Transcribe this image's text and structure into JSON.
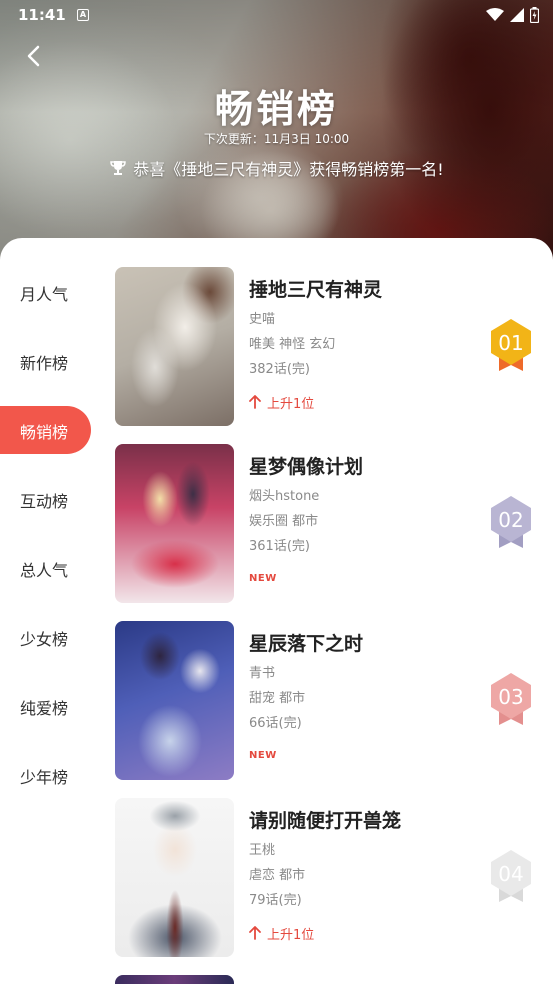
{
  "status_bar": {
    "time": "11:41",
    "notification_letter": "A"
  },
  "header": {
    "title": "畅销榜",
    "next_update": "下次更新：11月3日 10:00",
    "congrats": "恭喜《捶地三尺有神灵》获得畅销榜第一名!"
  },
  "sidebar": {
    "items": [
      {
        "label": "月人气"
      },
      {
        "label": "新作榜"
      },
      {
        "label": "畅销榜"
      },
      {
        "label": "互动榜"
      },
      {
        "label": "总人气"
      },
      {
        "label": "少女榜"
      },
      {
        "label": "纯爱榜"
      },
      {
        "label": "少年榜"
      }
    ],
    "active_label": "畅销榜"
  },
  "comics": [
    {
      "title": "捶地三尺有神灵",
      "author": "史喵",
      "tags": "唯美 神怪 玄幻",
      "episodes": "382话(完)",
      "badge_type": "rise",
      "badge_text": "上升1位",
      "rank": "01",
      "rank_color": "#f2b417"
    },
    {
      "title": "星梦偶像计划",
      "author": "烟头hstone",
      "tags": "娱乐圈 都市",
      "episodes": "361话(完)",
      "badge_type": "new",
      "badge_text": "NEW",
      "rank": "02",
      "rank_color": "#b9b5d3"
    },
    {
      "title": "星辰落下之时",
      "author": "青书",
      "tags": "甜宠 都市",
      "episodes": "66话(完)",
      "badge_type": "new",
      "badge_text": "NEW",
      "rank": "03",
      "rank_color": "#eea7a5"
    },
    {
      "title": "请别随便打开兽笼",
      "author": "王桃",
      "tags": "虐恋 都市",
      "episodes": "79话(完)",
      "badge_type": "rise",
      "badge_text": "上升1位",
      "rank": "04",
      "rank_color": "#e6e6e6"
    }
  ],
  "colors": {
    "accent": "#f2574b",
    "rise_text": "#e4493e"
  }
}
